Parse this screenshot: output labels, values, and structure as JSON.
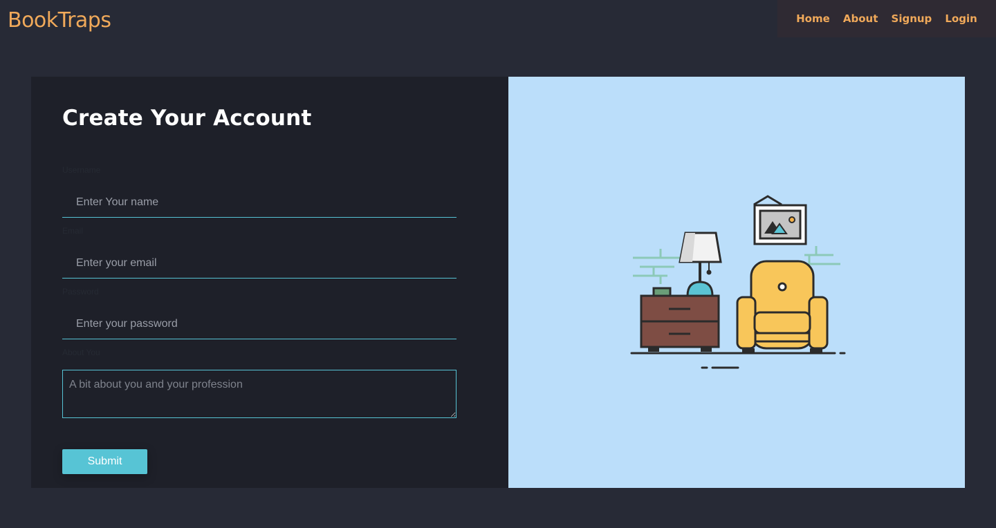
{
  "header": {
    "brand": "BookTraps",
    "nav": [
      "Home",
      "About",
      "Signup",
      "Login"
    ]
  },
  "form": {
    "title": "Create Your Account",
    "fields": [
      {
        "label": "Username",
        "placeholder": "Enter Your name",
        "value": ""
      },
      {
        "label": "Email",
        "placeholder": "Enter your email",
        "value": ""
      },
      {
        "label": "Password",
        "placeholder": "Enter your password",
        "value": ""
      },
      {
        "label": "About You",
        "placeholder": "A bit about you and your profession",
        "value": ""
      }
    ],
    "submit_label": "Submit"
  },
  "colors": {
    "background": "#272a36",
    "form_panel": "#1e2029",
    "accent": "#57c4d5",
    "brand": "#f0a95a",
    "illustration_bg": "#bbdefa"
  },
  "illustration": {
    "icons": [
      "picture-frame-icon",
      "lamp-icon",
      "nightstand-icon",
      "armchair-icon",
      "brick-wall-icon"
    ]
  }
}
